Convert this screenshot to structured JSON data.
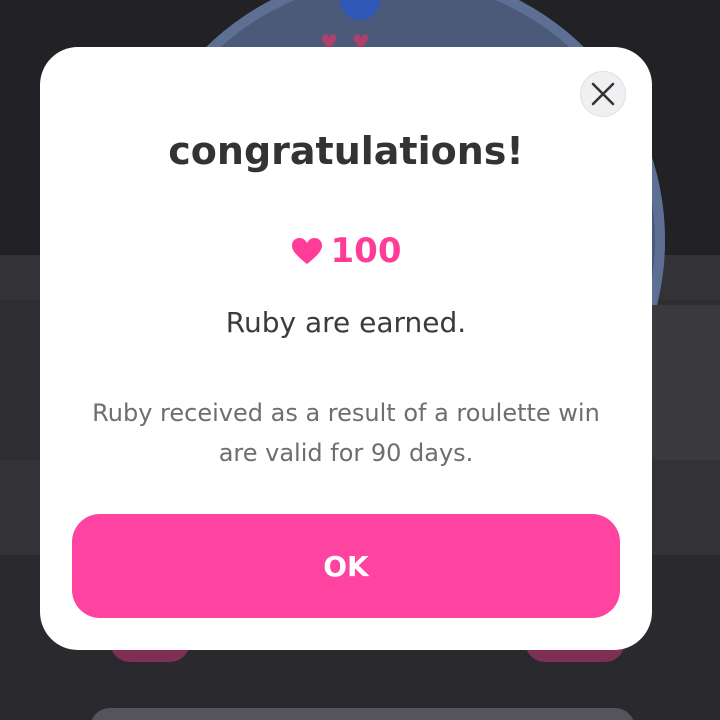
{
  "dialog": {
    "title": "congratulations!",
    "reward": {
      "icon": "heart-icon",
      "amount": "100",
      "color": "#ff3d98"
    },
    "earned_message": "Ruby are earned.",
    "notice_line1": "Ruby received as a result of a roulette win",
    "notice_line2": "are valid for 90 days.",
    "close_icon": "close-icon",
    "ok_label": "OK",
    "accent_color": "#ff43a0"
  }
}
